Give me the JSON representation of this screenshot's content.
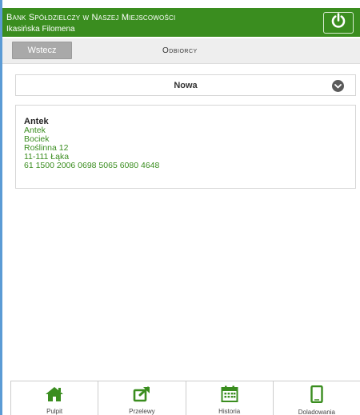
{
  "header": {
    "bank_name": "Bank Spółdzielczy w Naszej Miejscowości",
    "user_name": "Ikasińska Filomena"
  },
  "subbar": {
    "back_label": "Wstecz",
    "title": "Odbiorcy"
  },
  "new_row": {
    "label": "Nowa"
  },
  "recipient": {
    "name": "Antek",
    "lines": [
      "Antek",
      "Bociek",
      "Roślinna 12",
      "11-111 Łąka",
      "61 1500 2006 0698 5065 6080 4648"
    ]
  },
  "nav": {
    "items": [
      {
        "label": "Pulpit",
        "icon": "home-icon"
      },
      {
        "label": "Przelewy",
        "icon": "external-transfer-icon"
      },
      {
        "label": "Historia",
        "icon": "calendar-icon"
      },
      {
        "label": "Doladowania",
        "icon": "mobile-phone-icon"
      }
    ]
  },
  "colors": {
    "brand_green": "#3a8d1f",
    "back_button_gray": "#a9a9a9"
  }
}
